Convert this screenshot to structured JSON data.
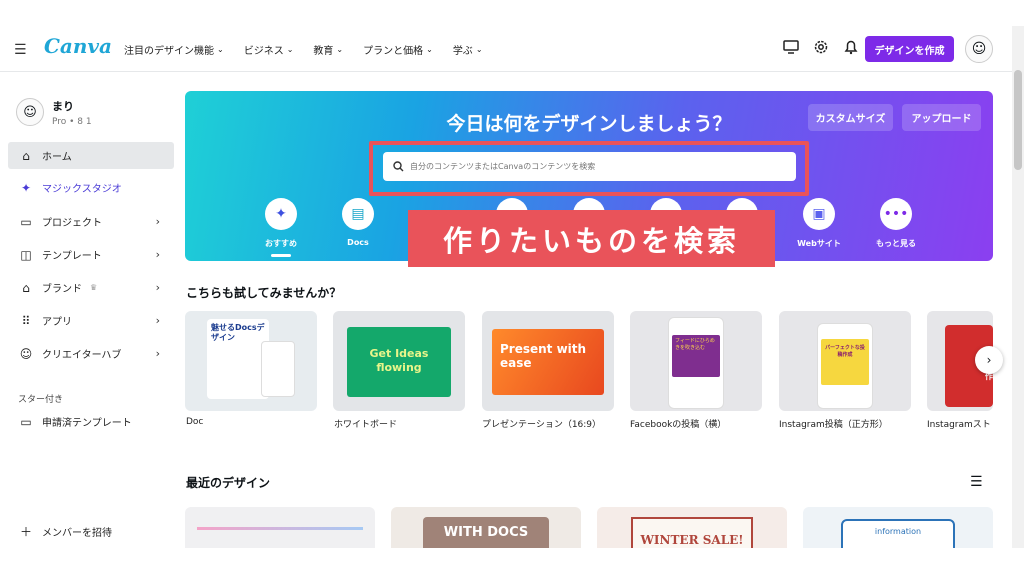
{
  "app": {
    "logo": "Canva"
  },
  "nav": {
    "items": [
      {
        "label": "注目のデザイン機能"
      },
      {
        "label": "ビジネス"
      },
      {
        "label": "教育"
      },
      {
        "label": "プランと価格"
      },
      {
        "label": "学ぶ"
      }
    ],
    "create_button": "デザインを作成"
  },
  "user": {
    "name": "まり",
    "plan": "Pro • 8 1"
  },
  "sidebar": {
    "items": [
      {
        "label": "ホーム"
      },
      {
        "label": "マジックスタジオ"
      },
      {
        "label": "プロジェクト"
      },
      {
        "label": "テンプレート"
      },
      {
        "label": "ブランド"
      },
      {
        "label": "アプリ"
      },
      {
        "label": "クリエイターハブ"
      }
    ],
    "starred_heading": "スター付き",
    "starred_items": [
      {
        "label": "申請済テンプレート"
      }
    ],
    "invite": "メンバーを招待"
  },
  "hero": {
    "title": "今日は何をデザインしましょう？",
    "custom_size": "カスタムサイズ",
    "upload": "アップロード",
    "search_placeholder": "自分のコンテンツまたはCanvaのコンテンツを検索",
    "categories": [
      {
        "label": "おすすめ",
        "icon": "sparkle-icon"
      },
      {
        "label": "Docs",
        "icon": "docs-icon"
      },
      {
        "label": "",
        "icon": "category-icon"
      },
      {
        "label": "",
        "icon": "category-icon"
      },
      {
        "label": "",
        "icon": "category-icon"
      },
      {
        "label": "",
        "icon": "category-icon"
      },
      {
        "label": "",
        "icon": "category-icon"
      },
      {
        "label": "Webサイト",
        "icon": "website-icon"
      },
      {
        "label": "もっと見る",
        "icon": "more-icon"
      }
    ]
  },
  "overlay": {
    "caption": "作りたいものを検索"
  },
  "try_section": {
    "title": "こちらも試してみませんか？",
    "cards": [
      {
        "label": "Doc",
        "thumb_text": "魅せるDocsデザイン"
      },
      {
        "label": "ホワイトボード",
        "thumb_text": "Get Ideas flowing"
      },
      {
        "label": "プレゼンテーション（16:9）",
        "thumb_text": "Present with ease"
      },
      {
        "label": "Facebookの投稿（横）",
        "thumb_text": "フィードにひらめきを吹き込む"
      },
      {
        "label": "Instagram投稿（正方形）",
        "thumb_text": "パーフェクトな投稿作成"
      },
      {
        "label": "Instagramスト",
        "thumb_text": "作"
      }
    ]
  },
  "recent_section": {
    "title": "最近のデザイン",
    "items": [
      {
        "thumb_text": ""
      },
      {
        "thumb_text": "WITH DOCS"
      },
      {
        "thumb_text": "WINTER SALE!"
      },
      {
        "thumb_text": "information"
      }
    ]
  },
  "colors": {
    "accent": "#7d2ae8",
    "highlight": "#e9535a",
    "logo": "#1fa6d6"
  }
}
